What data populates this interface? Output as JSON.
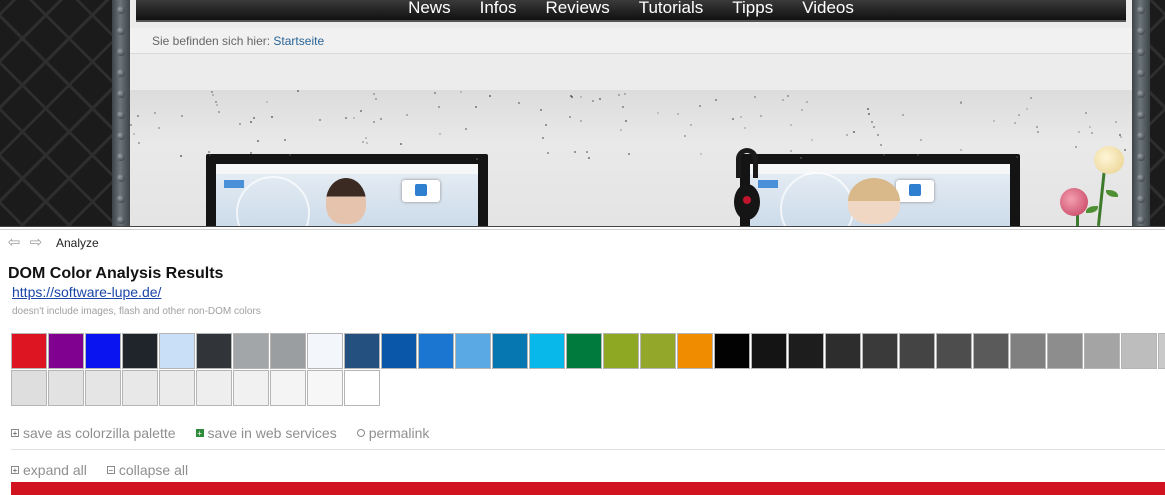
{
  "site": {
    "nav": [
      "News",
      "Infos",
      "Reviews",
      "Tutorials",
      "Tipps",
      "Videos"
    ],
    "breadcrumb": {
      "prefix": "Sie befinden sich hier:",
      "link": "Startseite"
    }
  },
  "analyzer": {
    "toolbar": {
      "back_icon": "left-arrow-icon",
      "forward_icon": "right-arrow-icon",
      "title": "Analyze"
    },
    "heading": "DOM Color Analysis Results",
    "url": "https://software-lupe.de/",
    "note": "doesn't include images, flash and other non-DOM colors",
    "swatches": [
      "#dd1522",
      "#800090",
      "#0a14f0",
      "#20252b",
      "#c9dff7",
      "#31353a",
      "#a3a6a9",
      "#9b9ea1",
      "#f3f6fa",
      "#24507f",
      "#0a56a8",
      "#1b76d2",
      "#5aa8e4",
      "#0677b1",
      "#09b8ea",
      "#017b3d",
      "#8ea823",
      "#93a72b",
      "#f08c00",
      "#020202",
      "#141414",
      "#1d1d1d",
      "#2d2d2d",
      "#3a3a3a",
      "#444444",
      "#4d4d4d",
      "#5a5a5a",
      "#808080",
      "#8d8d8d",
      "#a4a4a4",
      "#bdbdbd",
      "#c9c9c9",
      "#dedede",
      "#e2e2e2",
      "#e5e5e5",
      "#e8e8e8",
      "#ebebeb",
      "#eeeeee",
      "#f1f1f1",
      "#f4f4f4",
      "#f7f7f7",
      "#ffffff"
    ],
    "actions": {
      "save_palette": "save as colorzilla palette",
      "save_web": "save in web services",
      "permalink": "permalink",
      "expand": "expand all",
      "collapse": "collapse all"
    },
    "accent_color": "#d1121f"
  }
}
